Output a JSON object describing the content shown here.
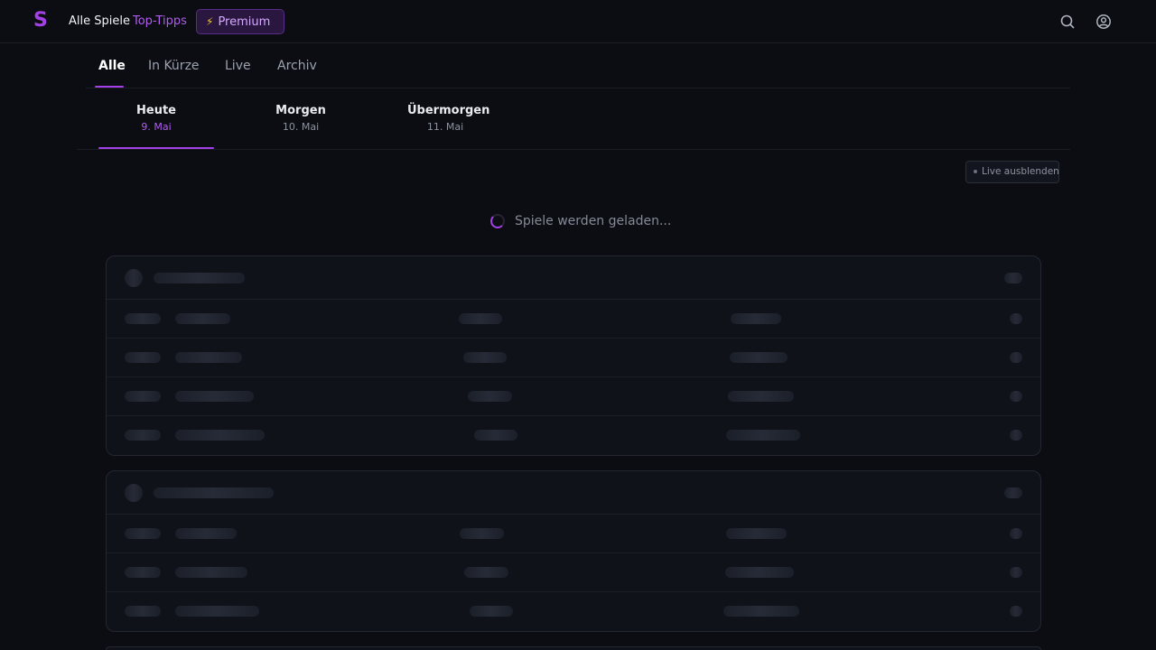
{
  "brand": {
    "logo_letter": "S",
    "accent_color": "#a340e8"
  },
  "nav": {
    "all_games": "Alle Spiele",
    "top_tips": "Top-Tipps",
    "premium": "Premium",
    "premium_icon": "lightning-icon",
    "search_icon": "search-icon",
    "user_icon": "user-icon"
  },
  "tabs": [
    {
      "label": "Alle",
      "active": true
    },
    {
      "label": "In Kürze",
      "active": false
    },
    {
      "label": "Live",
      "active": false
    },
    {
      "label": "Archiv",
      "active": false
    }
  ],
  "days": [
    {
      "name": "Heute",
      "date": "9. Mai",
      "active": true
    },
    {
      "name": "Morgen",
      "date": "10. Mai",
      "active": false
    },
    {
      "name": "Übermorgen",
      "date": "11. Mai",
      "active": false
    }
  ],
  "live_toggle": {
    "label": "Live ausblenden"
  },
  "loading": {
    "text": "Spiele werden geladen..."
  }
}
